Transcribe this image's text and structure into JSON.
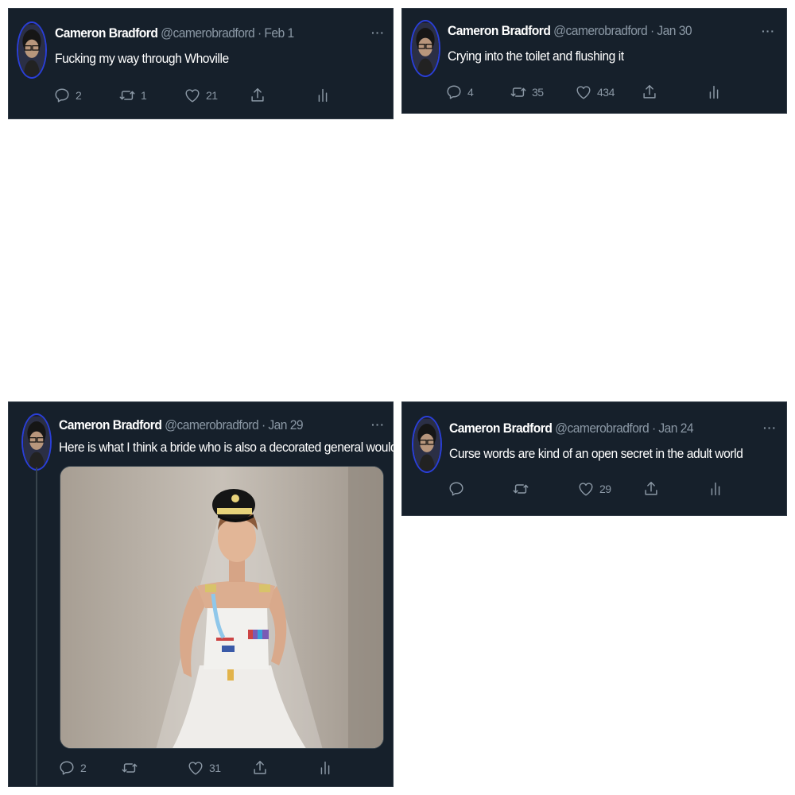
{
  "tweets": [
    {
      "name": "Cameron Bradford",
      "handle": "@camerobradford",
      "sep": "·",
      "date": "Feb 1",
      "text": "Fucking my way through Whoville",
      "replies": "2",
      "retweets": "1",
      "likes": "21"
    },
    {
      "name": "Cameron Bradford",
      "handle": "@camerobradford",
      "sep": "·",
      "date": "Jan 30",
      "text": "Crying into the toilet and flushing it",
      "replies": "4",
      "retweets": "35",
      "likes": "434"
    },
    {
      "name": "Cameron Bradford",
      "handle": "@camerobradford",
      "sep": "·",
      "date": "Jan 29",
      "text": "Here is what I think a bride who is also a decorated general would look like",
      "replies": "2",
      "retweets": "",
      "likes": "31"
    },
    {
      "name": "Cameron Bradford",
      "handle": "@camerobradford",
      "sep": "·",
      "date": "Jan 24",
      "text": "Curse words are kind of an open secret in the adult world",
      "replies": "",
      "retweets": "",
      "likes": "29"
    }
  ],
  "more_label": "···",
  "icons": {
    "reply": "reply-icon",
    "retweet": "retweet-icon",
    "like": "heart-icon",
    "share": "share-icon",
    "analytics": "analytics-icon",
    "more": "more-icon"
  },
  "colors": {
    "card_bg": "#16202b",
    "muted": "#8b98a5",
    "text": "#ffffff",
    "avatar_ring": "#2a3fd8"
  }
}
